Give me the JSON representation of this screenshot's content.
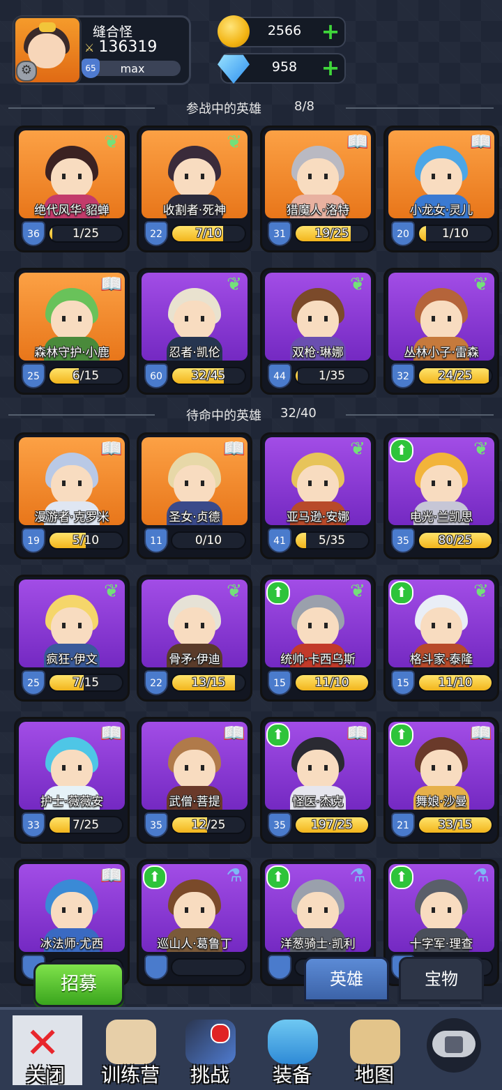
{
  "player": {
    "name": "缝合怪",
    "power": "136319",
    "level": "65",
    "level_text": "max"
  },
  "currency": {
    "gold": "2566",
    "gems": "958"
  },
  "active_section": {
    "title": "参战中的英雄",
    "count": "8/8"
  },
  "reserve_section": {
    "title": "待命中的英雄",
    "count": "32/40"
  },
  "active_heroes": [
    {
      "name": "绝代风华·貂蝉",
      "level": "36",
      "progress": "1/25",
      "fill": 0.04,
      "color": "orange",
      "badge": "wing",
      "hair": "#3b2222",
      "body": "#c33b6b"
    },
    {
      "name": "收割者·死神",
      "level": "22",
      "progress": "7/10",
      "fill": 0.7,
      "color": "orange",
      "badge": "wing",
      "hair": "#3a2b3a",
      "body": "#2b2b3b"
    },
    {
      "name": "猎魔人·洛特",
      "level": "31",
      "progress": "19/25",
      "fill": 0.76,
      "color": "orange",
      "badge": "book",
      "hair": "#b9b9c2",
      "body": "#e8b1a0"
    },
    {
      "name": "小龙女·灵儿",
      "level": "20",
      "progress": "1/10",
      "fill": 0.1,
      "color": "orange",
      "badge": "book",
      "hair": "#4ca6e6",
      "body": "#3a7ad2"
    },
    {
      "name": "森林守护·小鹿",
      "level": "25",
      "progress": "6/15",
      "fill": 0.4,
      "color": "orange",
      "badge": "book",
      "hair": "#69c25a",
      "body": "#4a8a3b"
    },
    {
      "name": "忍者·凯伦",
      "level": "60",
      "progress": "32/45",
      "fill": 0.71,
      "color": "purple",
      "badge": "wing",
      "hair": "#e9e2cf",
      "body": "#263550"
    },
    {
      "name": "双枪·琳娜",
      "level": "44",
      "progress": "1/35",
      "fill": 0.03,
      "color": "purple",
      "badge": "wing",
      "hair": "#7b4a2a",
      "body": "#6a4fb0"
    },
    {
      "name": "丛林小子·雷森",
      "level": "32",
      "progress": "24/25",
      "fill": 0.96,
      "color": "purple",
      "badge": "wing",
      "hair": "#b5643a",
      "body": "#c67a3c"
    }
  ],
  "reserve_heroes": [
    {
      "name": "漫游者·克罗米",
      "level": "19",
      "progress": "5/10",
      "fill": 0.5,
      "color": "orange",
      "badge": "book",
      "up": false,
      "hair": "#b9c9e6",
      "body": "#dfe6f2"
    },
    {
      "name": "圣女·贞德",
      "level": "11",
      "progress": "0/10",
      "fill": 0.0,
      "color": "orange",
      "badge": "book",
      "up": false,
      "hair": "#e7d8a8",
      "body": "#3a4a8a"
    },
    {
      "name": "亚马逊·安娜",
      "level": "41",
      "progress": "5/35",
      "fill": 0.14,
      "color": "purple",
      "badge": "wing",
      "up": false,
      "hair": "#e7c45a",
      "body": "#b84a2a"
    },
    {
      "name": "电光·兰凯思",
      "level": "35",
      "progress": "80/25",
      "fill": 1.0,
      "color": "purple",
      "badge": "wing",
      "up": true,
      "hair": "#f2b43a",
      "body": "#c6c6d6"
    },
    {
      "name": "疯狂·伊文",
      "level": "25",
      "progress": "7/15",
      "fill": 0.47,
      "color": "purple",
      "badge": "wing",
      "up": false,
      "hair": "#f5d66a",
      "body": "#3a5a9a"
    },
    {
      "name": "骨矛·伊迪",
      "level": "22",
      "progress": "13/15",
      "fill": 0.87,
      "color": "purple",
      "badge": "wing",
      "up": false,
      "hair": "#e6e2d6",
      "body": "#5a3b2a"
    },
    {
      "name": "统帅·卡西乌斯",
      "level": "15",
      "progress": "11/10",
      "fill": 1.0,
      "color": "purple",
      "badge": "wing",
      "up": true,
      "hair": "#9aa0ac",
      "body": "#c23a2a"
    },
    {
      "name": "格斗家·泰隆",
      "level": "15",
      "progress": "11/10",
      "fill": 1.0,
      "color": "purple",
      "badge": "wing",
      "up": true,
      "hair": "#e9eef6",
      "body": "#b84a2a"
    },
    {
      "name": "护士·薇薇安",
      "level": "33",
      "progress": "7/25",
      "fill": 0.28,
      "color": "purple",
      "badge": "book",
      "up": false,
      "hair": "#4ec6e6",
      "body": "#e6f2f8"
    },
    {
      "name": "武僧·菩提",
      "level": "35",
      "progress": "12/25",
      "fill": 0.48,
      "color": "purple",
      "badge": "book",
      "up": false,
      "hair": "#b07a4a",
      "body": "#6a3a2a"
    },
    {
      "name": "怪医·杰克",
      "level": "35",
      "progress": "197/25",
      "fill": 1.0,
      "color": "purple",
      "badge": "book",
      "up": true,
      "hair": "#2a2a32",
      "body": "#e6e6ee"
    },
    {
      "name": "舞娘·沙曼",
      "level": "21",
      "progress": "33/15",
      "fill": 1.0,
      "color": "purple",
      "badge": "book",
      "up": true,
      "hair": "#6a3a2a",
      "body": "#e6b04a"
    },
    {
      "name": "冰法师·尤西",
      "level": "",
      "progress": "",
      "fill": 0.0,
      "color": "purple",
      "badge": "book",
      "up": false,
      "hair": "#3a8ad6",
      "body": "#3a6ac2"
    },
    {
      "name": "巡山人·葛鲁丁",
      "level": "",
      "progress": "",
      "fill": 0.0,
      "color": "purple",
      "badge": "potion",
      "up": true,
      "hair": "#7a4a2a",
      "body": "#7a5a3a"
    },
    {
      "name": "洋葱骑士·凯利",
      "level": "",
      "progress": "",
      "fill": 0.0,
      "color": "purple",
      "badge": "potion",
      "up": true,
      "hair": "#9aa0ac",
      "body": "#5a5f6a"
    },
    {
      "name": "十字军·理查",
      "level": "",
      "progress": "",
      "fill": 0.0,
      "color": "purple",
      "badge": "potion",
      "up": true,
      "hair": "#5a5f6a",
      "body": "#4a4f5a"
    }
  ],
  "recruit_label": "招募",
  "tabs": {
    "heroes": "英雄",
    "treasure": "宝物"
  },
  "nav": {
    "close": "关闭",
    "training": "训练营",
    "challenge": "挑战",
    "equipment": "装备",
    "map": "地图"
  },
  "icons": {
    "gear": "gear-icon",
    "plus": "plus-icon",
    "wing": "wing-icon",
    "book": "book-icon",
    "potion": "potion-icon",
    "up": "upgrade-arrow-icon",
    "lock": "lock-icon"
  }
}
